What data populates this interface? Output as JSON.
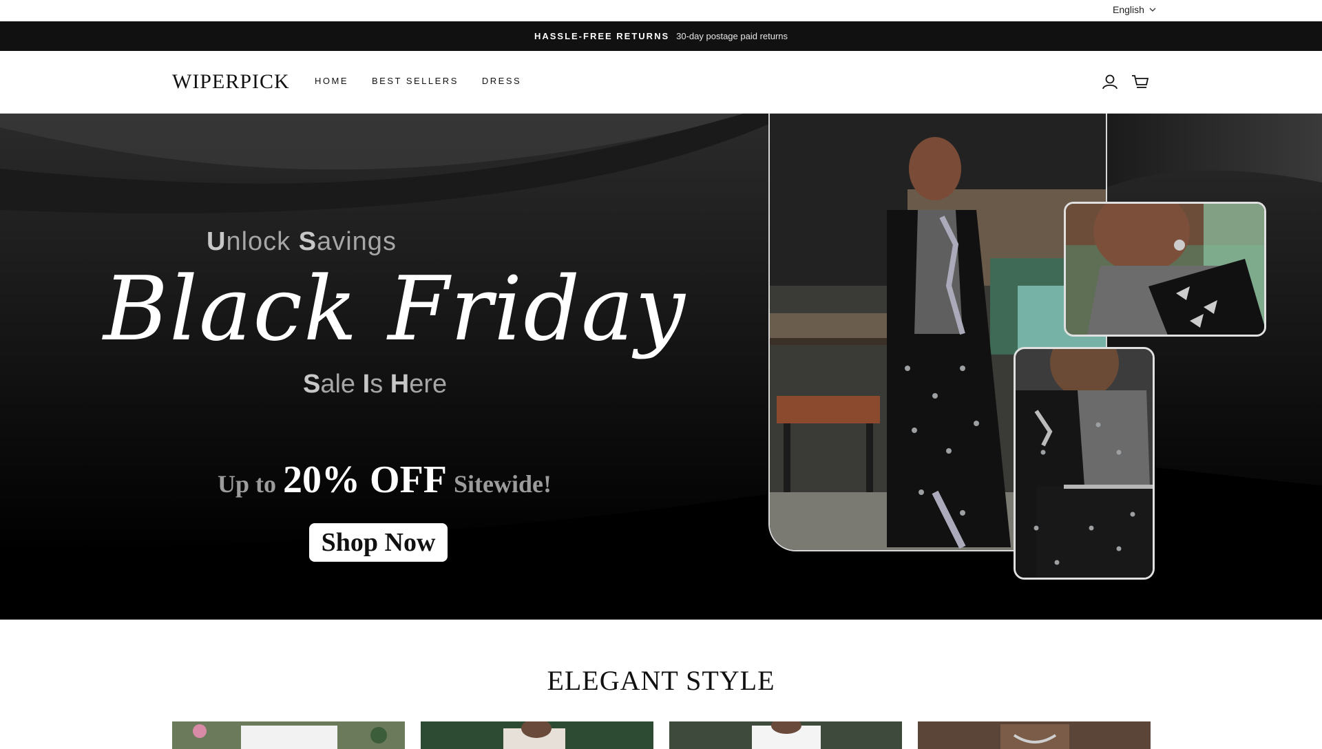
{
  "utility": {
    "language": "English"
  },
  "announcement": {
    "strong": "HASSLE-FREE RETURNS",
    "sub": "30-day postage paid returns"
  },
  "header": {
    "logo": "WIPERPICK",
    "nav": [
      "HOME",
      "BEST SELLERS",
      "DRESS"
    ],
    "icons": [
      "account-icon",
      "cart-icon"
    ]
  },
  "hero": {
    "unlock_a": "U",
    "unlock_b": "nlock ",
    "unlock_c": "S",
    "unlock_d": "avings",
    "script": "Black Friday",
    "sale_a": "S",
    "sale_b": "ale ",
    "sale_c": "I",
    "sale_d": "s ",
    "sale_e": "H",
    "sale_f": "ere",
    "offer_pre": "Up to",
    "offer_big": "20% OFF",
    "offer_post": "Sitewide!",
    "cta": "Shop Now",
    "slides_active": 1,
    "colors": {
      "bg": "#000000",
      "text": "#ffffff",
      "muted": "#a6a6a6"
    }
  },
  "section": {
    "title": "ELEGANT STYLE"
  }
}
